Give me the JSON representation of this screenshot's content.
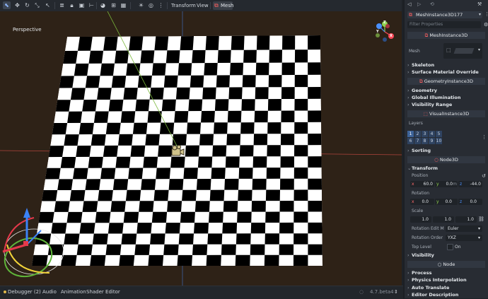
{
  "toolbar": {
    "transform_menu": "Transform",
    "view_menu": "View",
    "mesh_menu": "Mesh"
  },
  "viewport": {
    "label": "Perspective",
    "gizmo": {
      "x": "X",
      "y": "Y",
      "z": "Z"
    },
    "checker_dark": "#000000",
    "checker_light": "#ffffff",
    "background": "#2e2217"
  },
  "bottom": {
    "debugger": "Debugger (2)",
    "audio": "Audio",
    "animation": "Animation",
    "shader_editor": "Shader Editor",
    "version": "4.7.beta4"
  },
  "inspector": {
    "node_name": "MeshInstance3D177",
    "filter_placeholder": "Filter Properties",
    "class_meshinstance": "MeshInstance3D",
    "mesh_label": "Mesh",
    "skeleton": "Skeleton",
    "surface_override": "Surface Material Override",
    "class_geometry": "GeometryInstance3D",
    "geometry": "Geometry",
    "global_illumination": "Global Illumination",
    "visibility_range": "Visibility Range",
    "class_visual": "VisualInstance3D",
    "layers_label": "Layers",
    "layers_row1": [
      "1",
      "2",
      "3",
      "4",
      "5"
    ],
    "layers_row2": [
      "6",
      "7",
      "8",
      "9",
      "10"
    ],
    "sorting": "Sorting",
    "class_node3d": "Node3D",
    "transform": "Transform",
    "position_label": "Position",
    "position": {
      "x_label": "x",
      "x": "60.0",
      "y_label": "y",
      "y": "0.0",
      "y_unit": "m",
      "z_label": "z",
      "z": "-44.0"
    },
    "rotation_label": "Rotation",
    "rotation": {
      "x_label": "x",
      "x": "0.0",
      "y_label": "y",
      "y": "0.0",
      "z_label": "z",
      "z": "0.0"
    },
    "scale_label": "Scale",
    "scale": {
      "x": "1.0",
      "y": "1.0",
      "z": "1.0"
    },
    "rot_edit_label": "Rotation Edit M",
    "rot_edit_value": "Euler",
    "rot_order_label": "Rotation Order",
    "rot_order_value": "YXZ",
    "top_level_label": "Top Level",
    "top_level_value": "On",
    "visibility": "Visibility",
    "class_node": "Node",
    "process": "Process",
    "physics_interp": "Physics Interpolation",
    "auto_translate": "Auto Translate",
    "editor_description": "Editor Description"
  }
}
